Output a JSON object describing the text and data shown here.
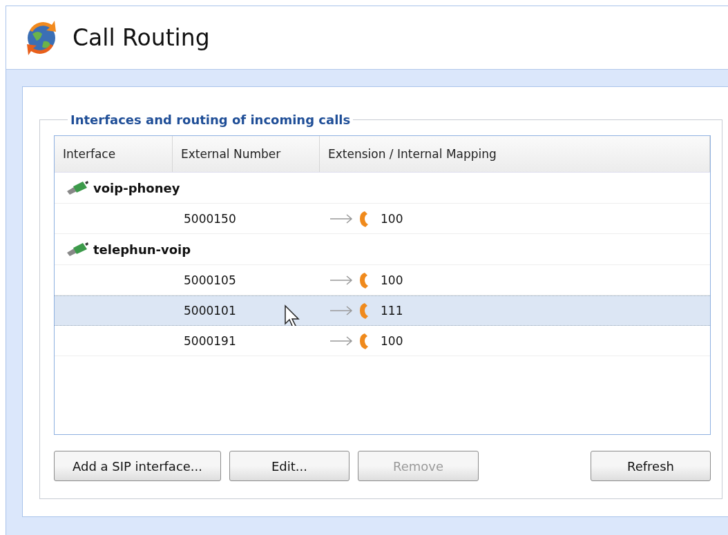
{
  "window": {
    "title": "Call Routing"
  },
  "group_box": {
    "legend": "Interfaces and routing of incoming calls"
  },
  "table": {
    "columns": [
      "Interface",
      "External Number",
      "Extension / Internal Mapping"
    ],
    "interfaces": [
      {
        "name": "voip-phoney",
        "children": [
          {
            "number": "5000150",
            "extension": "100",
            "selected": false
          }
        ]
      },
      {
        "name": "telephun-voip",
        "children": [
          {
            "number": "5000105",
            "extension": "100",
            "selected": false
          },
          {
            "number": "5000101",
            "extension": "111",
            "selected": true
          },
          {
            "number": "5000191",
            "extension": "100",
            "selected": false
          }
        ]
      }
    ]
  },
  "buttons": [
    {
      "label": "Add a SIP interface...",
      "disabled": false
    },
    {
      "label": "Edit...",
      "disabled": false
    },
    {
      "label": "Remove",
      "disabled": true
    },
    {
      "label": "Refresh",
      "disabled": false
    }
  ]
}
